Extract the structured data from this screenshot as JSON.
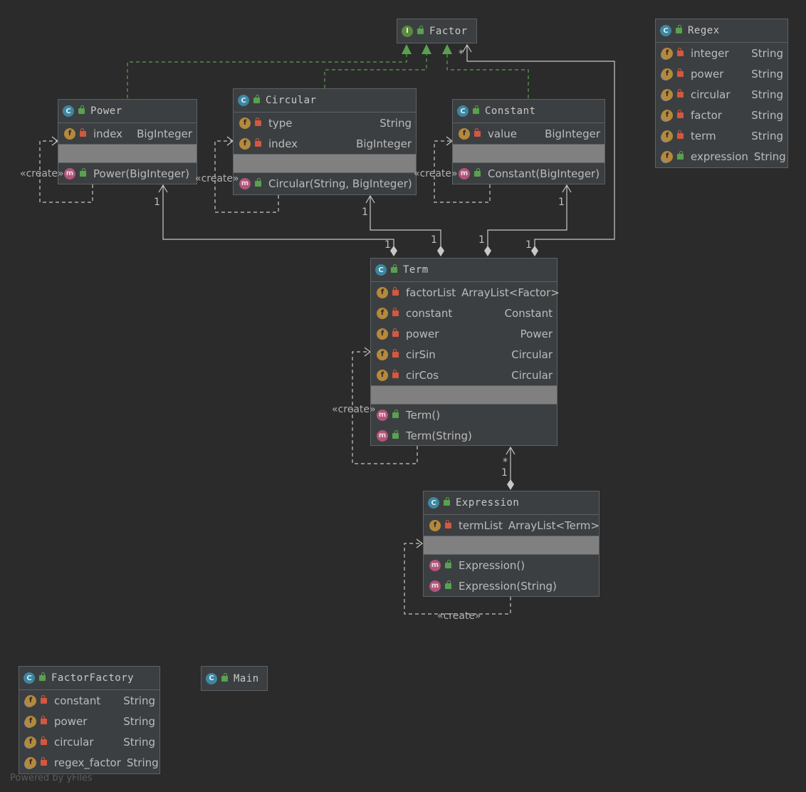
{
  "classes": {
    "factor": {
      "kind": "interface",
      "name": "Factor"
    },
    "power": {
      "name": "Power",
      "fields": [
        {
          "name": "index",
          "type": "BigInteger"
        }
      ],
      "methods": [
        {
          "name": "Power(BigInteger)"
        }
      ]
    },
    "circular": {
      "name": "Circular",
      "fields": [
        {
          "name": "type",
          "type": "String"
        },
        {
          "name": "index",
          "type": "BigInteger"
        }
      ],
      "methods": [
        {
          "name": "Circular(String, BigInteger)"
        }
      ]
    },
    "constant": {
      "name": "Constant",
      "fields": [
        {
          "name": "value",
          "type": "BigInteger"
        }
      ],
      "methods": [
        {
          "name": "Constant(BigInteger)"
        }
      ]
    },
    "regex": {
      "name": "Regex",
      "fields": [
        {
          "name": "integer",
          "type": "String"
        },
        {
          "name": "power",
          "type": "String"
        },
        {
          "name": "circular",
          "type": "String"
        },
        {
          "name": "factor",
          "type": "String"
        },
        {
          "name": "term",
          "type": "String"
        },
        {
          "name": "expression",
          "type": "String"
        }
      ]
    },
    "term": {
      "name": "Term",
      "fields": [
        {
          "name": "factorList",
          "type": "ArrayList<Factor>"
        },
        {
          "name": "constant",
          "type": "Constant"
        },
        {
          "name": "power",
          "type": "Power"
        },
        {
          "name": "cirSin",
          "type": "Circular"
        },
        {
          "name": "cirCos",
          "type": "Circular"
        }
      ],
      "methods": [
        {
          "name": "Term()"
        },
        {
          "name": "Term(String)"
        }
      ]
    },
    "expression": {
      "name": "Expression",
      "fields": [
        {
          "name": "termList",
          "type": "ArrayList<Term>"
        }
      ],
      "methods": [
        {
          "name": "Expression()"
        },
        {
          "name": "Expression(String)"
        }
      ]
    },
    "factorfactory": {
      "name": "FactorFactory",
      "fields": [
        {
          "name": "constant",
          "type": "String"
        },
        {
          "name": "power",
          "type": "String"
        },
        {
          "name": "circular",
          "type": "String"
        },
        {
          "name": "regex_factor",
          "type": "String"
        }
      ]
    },
    "main": {
      "name": "Main"
    }
  },
  "badges": {
    "class": "C",
    "interface": "I",
    "field": "f",
    "method": "m"
  },
  "annotations": {
    "create": "«create»"
  },
  "multiplicities": {
    "one": "1",
    "many": "*"
  },
  "footer": "Powered by yFiles",
  "colors": {
    "background": "#2b2b2b",
    "node": "#3c3f41",
    "separator": "#808080",
    "realization": "#59a14f",
    "edge": "#c8c8c8"
  }
}
